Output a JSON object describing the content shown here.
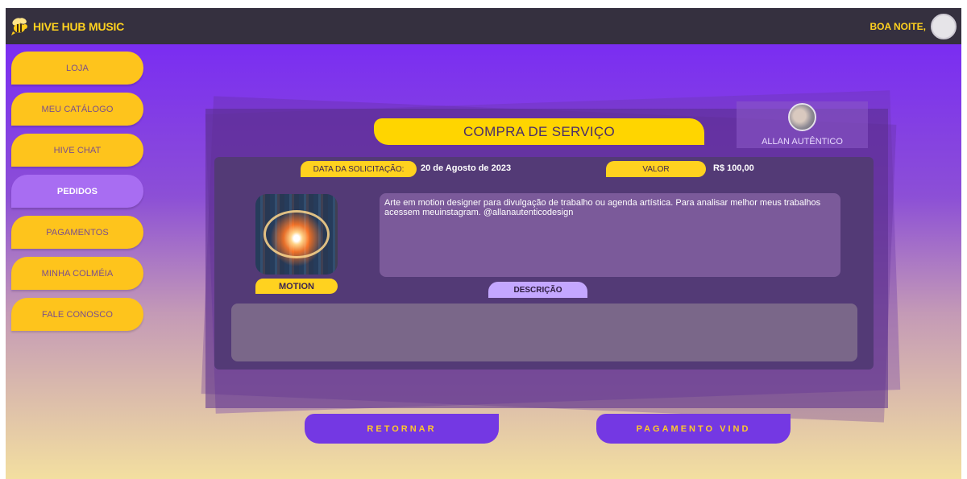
{
  "app": {
    "name": "HIVE HUB MUSIC",
    "greeting": "BOA NOITE,"
  },
  "sidebar": {
    "items": [
      {
        "label": "LOJA",
        "active": false
      },
      {
        "label": "MEU CATÁLOGO",
        "active": false
      },
      {
        "label": "HIVE CHAT",
        "active": false
      },
      {
        "label": "PEDIDOS",
        "active": true
      },
      {
        "label": "PAGAMENTOS",
        "active": false
      },
      {
        "label": "MINHA COLMÉIA",
        "active": false
      },
      {
        "label": "FALE CONOSCO",
        "active": false
      }
    ]
  },
  "order": {
    "title": "COMPRA DE SERVIÇO",
    "seller_name": "ALLAN AUTÊNTICO",
    "date_label": "DATA DA SOLICITAÇÃO:",
    "date_value": "20 de Agosto de 2023",
    "value_label": "VALOR",
    "value_amount": "R$ 100,00",
    "category": "MOTION",
    "description": "Arte em motion designer para divulgação de trabalho ou agenda artística. Para analisar melhor meus trabalhos acessem meuinstagram. @allanautenticodesign",
    "description_label": "DESCRIÇÃO"
  },
  "actions": {
    "back_label": "RETORNAR",
    "pay_label": "PAGAMENTO VIND"
  },
  "colors": {
    "accent": "#ffd21f",
    "primary": "#7438e3",
    "topbar": "#35303f",
    "panel": "#533a76"
  }
}
